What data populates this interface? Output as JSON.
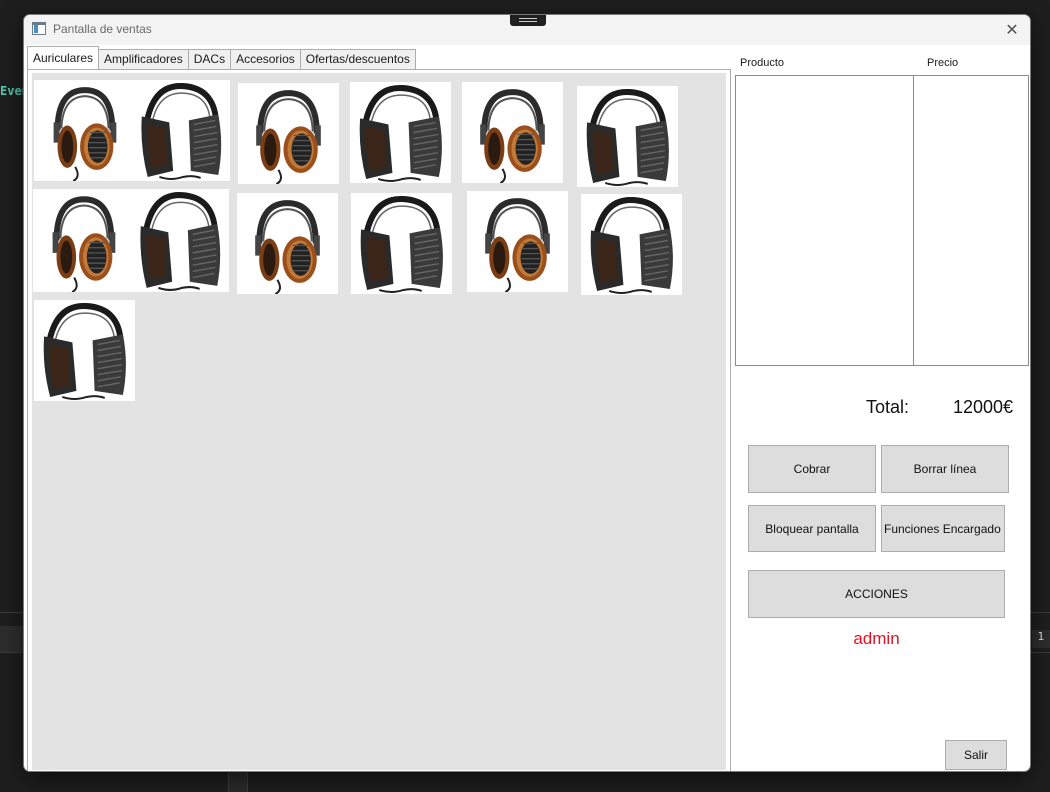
{
  "background": {
    "side_text": "Even",
    "panel_number": "1"
  },
  "window": {
    "title": "Pantalla de ventas",
    "close_glyph": "✕"
  },
  "tabs": [
    {
      "label": "Auriculares",
      "active": true
    },
    {
      "label": "Amplificadores",
      "active": false
    },
    {
      "label": "DACs",
      "active": false
    },
    {
      "label": "Accesorios",
      "active": false
    },
    {
      "label": "Ofertas/descuentos",
      "active": false
    }
  ],
  "products": [
    {
      "image": "headphone-pair-wood-and-black"
    },
    {
      "image": "headphone-wood"
    },
    {
      "image": "headphone-black"
    },
    {
      "image": "headphone-wood"
    },
    {
      "image": "headphone-black"
    },
    {
      "image": "headphone-pair-wood-and-black"
    },
    {
      "image": "headphone-wood"
    },
    {
      "image": "headphone-black"
    },
    {
      "image": "headphone-wood"
    },
    {
      "image": "headphone-black"
    },
    {
      "image": "headphone-black"
    }
  ],
  "order": {
    "columns": {
      "product": "Producto",
      "price": "Precio"
    },
    "rows": [],
    "total_label": "Total:",
    "total_value": "12000€"
  },
  "actions": {
    "charge": "Cobrar",
    "delete_line": "Borrar línea",
    "lock_screen": "Bloquear pantalla",
    "manager_functions": "Funciones Encargado",
    "actions": "ACCIONES",
    "exit": "Salir"
  },
  "user": {
    "name": "admin"
  },
  "colors": {
    "user_text": "#e81123",
    "product_area_bg": "#e3e3e3",
    "button_bg": "#dddddd"
  }
}
